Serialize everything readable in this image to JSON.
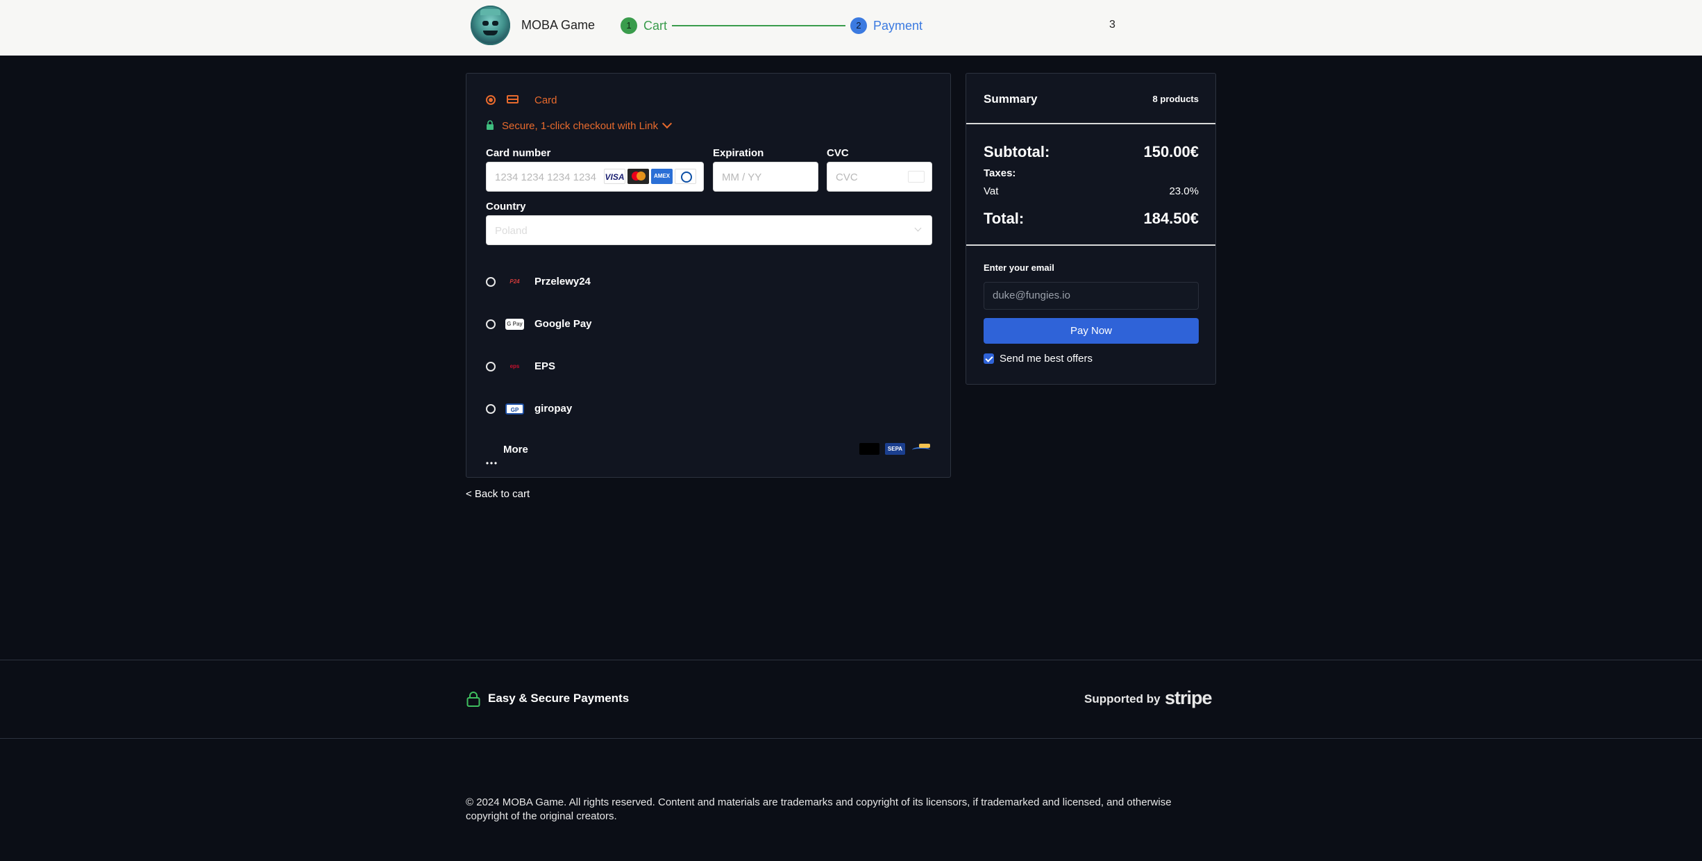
{
  "header": {
    "brand": "MOBA Game",
    "steps": [
      {
        "number": "1",
        "label": "Cart"
      },
      {
        "number": "2",
        "label": "Payment"
      }
    ],
    "cart_count": "3"
  },
  "payment": {
    "card_label": "Card",
    "link_text": "Secure, 1-click checkout with Link",
    "card_number_label": "Card number",
    "card_number_placeholder": "1234 1234 1234 1234",
    "card_brands": [
      "VISA",
      "Mastercard",
      "AMEX",
      "Diners"
    ],
    "expiration_label": "Expiration",
    "expiration_placeholder": "MM / YY",
    "cvc_label": "CVC",
    "cvc_placeholder": "CVC",
    "country_label": "Country",
    "country_value": "Poland",
    "methods": [
      {
        "label": "Przelewy24",
        "icon": "P24"
      },
      {
        "label": "Google Pay",
        "icon": "G Pay"
      },
      {
        "label": "EPS",
        "icon": "eps"
      },
      {
        "label": "giropay",
        "icon": "GP"
      }
    ],
    "more_label": "More",
    "more_logos": [
      "",
      "SEPA",
      ""
    ]
  },
  "back_link": "< Back to cart",
  "summary": {
    "title": "Summary",
    "count": "8 products",
    "subtotal_label": "Subtotal:",
    "subtotal_value": "150.00€",
    "taxes_label": "Taxes:",
    "vat_label": "Vat",
    "vat_value": "23.0%",
    "total_label": "Total:",
    "total_value": "184.50€",
    "email_label": "Enter your email",
    "email_placeholder": "duke@fungies.io",
    "pay_button": "Pay Now",
    "offers_label": "Send me best offers"
  },
  "footer": {
    "secure_text": "Easy & Secure Payments",
    "supported_text": "Supported by",
    "stripe": "stripe",
    "copyright": "© 2024 MOBA Game. All rights reserved. Content and materials are trademarks and copyright of its licensors, if trademarked and licensed, and otherwise copyright of the original creators."
  },
  "colors": {
    "accent_orange": "#e86a2d",
    "accent_blue": "#2f63d8",
    "step_green": "#3a9c4c",
    "background": "#0b0e16"
  }
}
